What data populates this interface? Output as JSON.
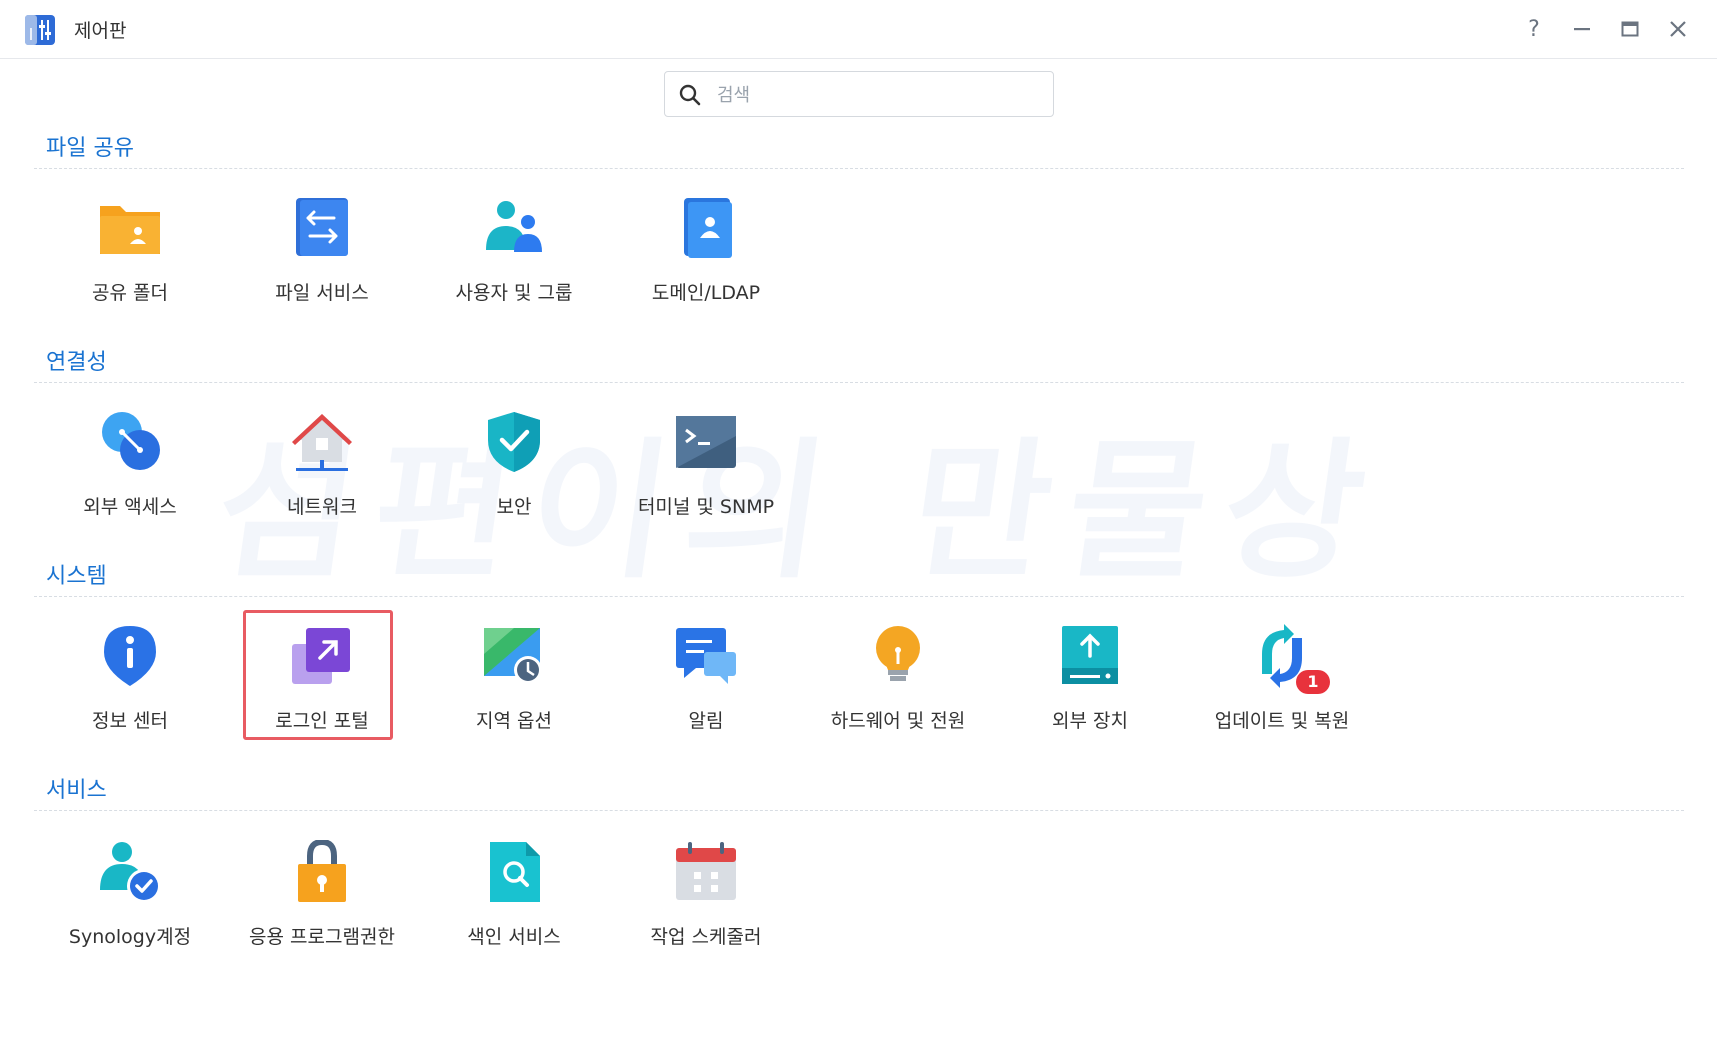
{
  "window": {
    "title": "제어판",
    "controls": [
      "help-icon",
      "minimize-icon",
      "maximize-icon",
      "close-icon"
    ]
  },
  "search": {
    "placeholder": "검색",
    "value": ""
  },
  "watermark": "섬편이의 만물상",
  "sections": [
    {
      "title": "파일 공유",
      "items": [
        {
          "label": "공유 폴더",
          "icon": "shared-folder-icon"
        },
        {
          "label": "파일 서비스",
          "icon": "file-services-icon"
        },
        {
          "label": "사용자 및 그룹",
          "icon": "user-group-icon"
        },
        {
          "label": "도메인/LDAP",
          "icon": "domain-ldap-icon"
        }
      ]
    },
    {
      "title": "연결성",
      "items": [
        {
          "label": "외부 액세스",
          "icon": "external-access-icon"
        },
        {
          "label": "네트워크",
          "icon": "network-icon"
        },
        {
          "label": "보안",
          "icon": "security-shield-icon"
        },
        {
          "label": "터미널 및 SNMP",
          "icon": "terminal-icon"
        }
      ]
    },
    {
      "title": "시스템",
      "items": [
        {
          "label": "정보 센터",
          "icon": "info-center-icon"
        },
        {
          "label": "로그인 포털",
          "icon": "login-portal-icon"
        },
        {
          "label": "지역 옵션",
          "icon": "regional-options-icon"
        },
        {
          "label": "알림",
          "icon": "notification-icon"
        },
        {
          "label": "하드웨어 및 전원",
          "icon": "hardware-power-icon"
        },
        {
          "label": "외부 장치",
          "icon": "external-devices-icon"
        },
        {
          "label": "업데이트 및 복원",
          "icon": "update-restore-icon",
          "badge": "1"
        }
      ]
    },
    {
      "title": "서비스",
      "items": [
        {
          "label": "Synology계정",
          "icon": "synology-account-icon"
        },
        {
          "label": "응용 프로그램권한",
          "icon": "app-privileges-icon"
        },
        {
          "label": "색인 서비스",
          "icon": "indexing-service-icon"
        },
        {
          "label": "작업 스케줄러",
          "icon": "task-scheduler-icon"
        }
      ]
    }
  ],
  "colors": {
    "accent": "#1a73d1",
    "highlight_border": "#e85b62",
    "badge": "#e8323c"
  }
}
